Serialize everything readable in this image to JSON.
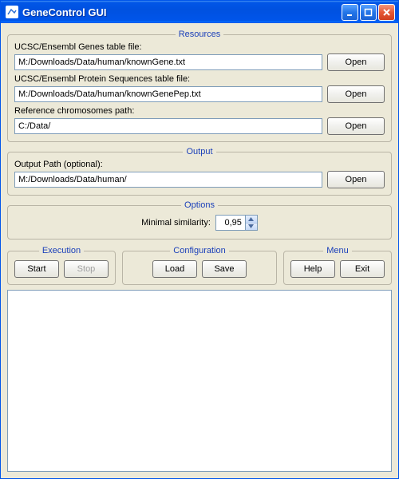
{
  "window": {
    "title": "GeneControl GUI"
  },
  "resources": {
    "legend": "Resources",
    "genes_label": "UCSC/Ensembl Genes table file:",
    "genes_value": "M:/Downloads/Data/human/knownGene.txt",
    "protein_label": "UCSC/Ensembl Protein Sequences table file:",
    "protein_value": "M:/Downloads/Data/human/knownGenePep.txt",
    "chrom_label": "Reference chromosomes path:",
    "chrom_value": "C:/Data/",
    "open_label": "Open"
  },
  "output": {
    "legend": "Output",
    "path_label": "Output Path (optional):",
    "path_value": "M:/Downloads/Data/human/",
    "open_label": "Open"
  },
  "options": {
    "legend": "Options",
    "minsim_label": "Minimal similarity:",
    "minsim_value": "0,95"
  },
  "execution": {
    "legend": "Execution",
    "start_label": "Start",
    "stop_label": "Stop"
  },
  "configuration": {
    "legend": "Configuration",
    "load_label": "Load",
    "save_label": "Save"
  },
  "menu": {
    "legend": "Menu",
    "help_label": "Help",
    "exit_label": "Exit"
  }
}
